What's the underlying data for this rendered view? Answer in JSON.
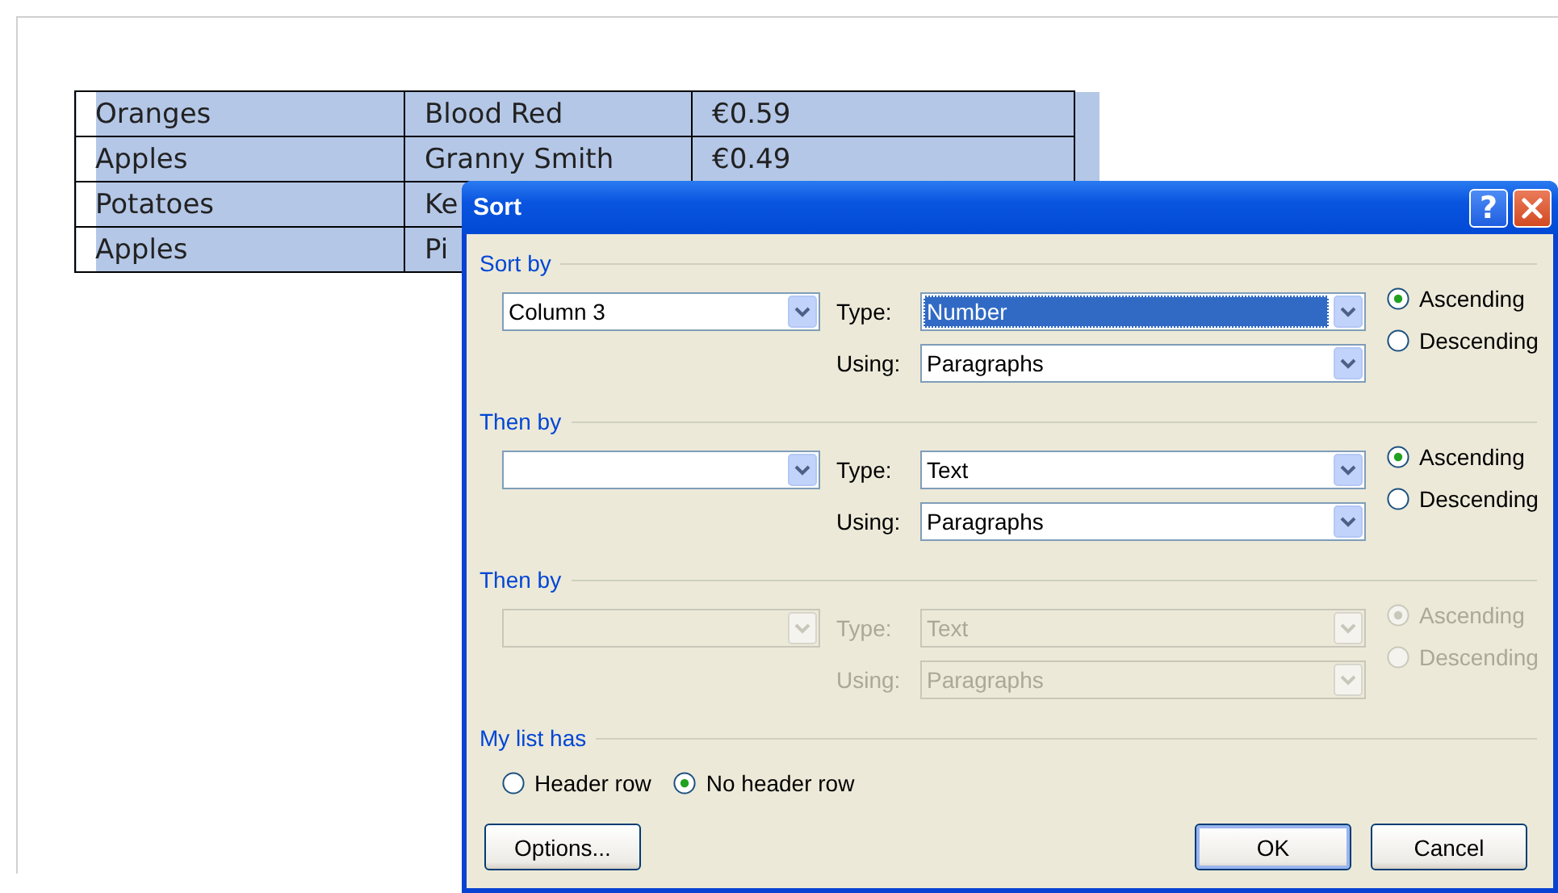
{
  "document": {
    "table": {
      "rows": [
        {
          "selected": true,
          "cells": [
            "Oranges",
            "Blood Red",
            "€0.59"
          ]
        },
        {
          "selected": true,
          "cells": [
            "Apples",
            "Granny Smith",
            "€0.49"
          ]
        },
        {
          "selected": true,
          "cells": [
            "Potatoes",
            "Ke",
            ""
          ]
        },
        {
          "selected": true,
          "cells": [
            "Apples",
            "Pi",
            ""
          ]
        }
      ]
    }
  },
  "dialog": {
    "title": "Sort",
    "help_button": "?",
    "sections": [
      {
        "label": "Sort by",
        "disabled": false,
        "column": {
          "value": "Column 3"
        },
        "type_label": "Type:",
        "type": {
          "value": "Number",
          "highlighted": true
        },
        "using_label": "Using:",
        "using": {
          "value": "Paragraphs",
          "highlighted": false
        },
        "order": [
          {
            "label": "Ascending",
            "selected": true
          },
          {
            "label": "Descending",
            "selected": false
          }
        ]
      },
      {
        "label": "Then by",
        "disabled": false,
        "type_label": "Type:",
        "type": {
          "value": "Text",
          "highlighted": false
        },
        "using_label": "Using:",
        "using": {
          "value": "Paragraphs",
          "highlighted": false
        },
        "order": [
          {
            "label": "Ascending",
            "selected": true
          },
          {
            "label": "Descending",
            "selected": false
          }
        ]
      },
      {
        "label": "Then by",
        "disabled": true,
        "type_label": "Type:",
        "type": {
          "value": "Text",
          "highlighted": false
        },
        "using_label": "Using:",
        "using": {
          "value": "Paragraphs",
          "highlighted": false
        },
        "order": [
          {
            "label": "Ascending",
            "selected": true
          },
          {
            "label": "Descending",
            "selected": false
          }
        ]
      }
    ],
    "list_has": {
      "label": "My list has",
      "options": [
        {
          "label": "Header row",
          "selected": false
        },
        {
          "label": "No header row",
          "selected": true
        }
      ]
    },
    "buttons": [
      {
        "label": "Options...",
        "default": false
      },
      {
        "label": "OK",
        "default": true
      },
      {
        "label": "Cancel",
        "default": false
      }
    ]
  }
}
